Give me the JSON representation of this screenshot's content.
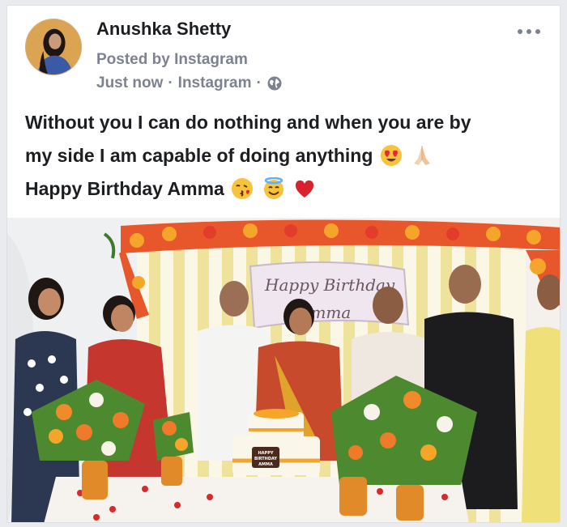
{
  "post": {
    "author_name": "Anushka Shetty",
    "posted_by": "Posted by Instagram",
    "timestamp": "Just now",
    "source": "Instagram",
    "separator": "·",
    "privacy_icon": "globe-icon",
    "more_icon": "more-options-icon",
    "caption_line1": "Without you I can do nothing and when you are by",
    "caption_line2": "my side I am capable of doing anything",
    "caption_line3": "Happy Birthday Amma",
    "emojis_line2": [
      "heart-eyes-emoji",
      "folded-hands-emoji"
    ],
    "emojis_line3": [
      "kissing-emoji",
      "halo-emoji",
      "red-heart-emoji"
    ]
  },
  "photo": {
    "sign_line1": "Happy Birthday",
    "sign_line2": "Amma",
    "cake_topper_line1": "HAPPY",
    "cake_topper_line2": "BIRTHDAY",
    "cake_topper_line3": "AMMA"
  },
  "colors": {
    "name_text": "#1c1e21",
    "meta_text": "#7d8290",
    "card_bg": "#ffffff",
    "page_bg": "#e9ebee"
  }
}
